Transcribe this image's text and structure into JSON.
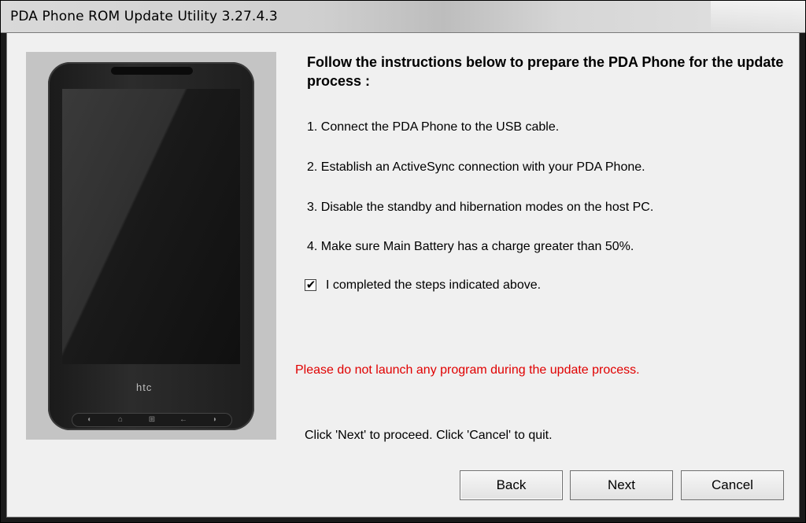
{
  "window": {
    "title": "PDA Phone ROM Update Utility 3.27.4.3"
  },
  "phone": {
    "brand": "htc",
    "buttons": [
      "phone-call-icon",
      "home-icon",
      "windows-icon",
      "back-arrow-icon",
      "end-call-icon"
    ]
  },
  "content": {
    "heading": "Follow the instructions below to prepare the PDA Phone for the update process :",
    "steps": [
      "1. Connect the PDA Phone to the USB cable.",
      "2. Establish an ActiveSync connection with your PDA Phone.",
      "3. Disable the standby and hibernation modes on the host PC.",
      "4. Make sure Main Battery has a charge greater than 50%."
    ],
    "confirm_checkbox": {
      "label": "I completed the steps indicated above.",
      "checked": true,
      "mark": "✔"
    },
    "warning": "Please do not launch any program during the update process.",
    "hint": "Click 'Next' to proceed. Click 'Cancel' to quit.",
    "warning_color": "#e00000"
  },
  "buttons": {
    "back": "Back",
    "next": "Next",
    "cancel": "Cancel"
  }
}
